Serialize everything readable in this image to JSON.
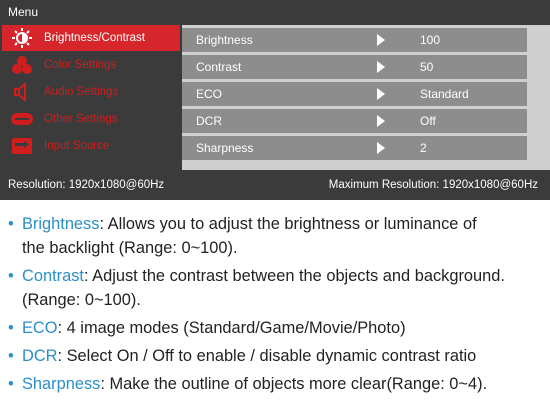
{
  "osd": {
    "title": "Menu",
    "menu_items": [
      {
        "label": "Brightness/Contrast",
        "icon": "brightness-icon",
        "active": true
      },
      {
        "label": "Color Settings",
        "icon": "color-icon",
        "active": false
      },
      {
        "label": "Audio Settings",
        "icon": "speaker-icon",
        "active": false
      },
      {
        "label": "Other Settings",
        "icon": "settings-icon",
        "active": false
      },
      {
        "label": "Input Source",
        "icon": "input-icon",
        "active": false
      }
    ],
    "submenu": [
      {
        "label": "Brightness",
        "value": "100"
      },
      {
        "label": "Contrast",
        "value": "50"
      },
      {
        "label": "ECO",
        "value": "Standard"
      },
      {
        "label": "DCR",
        "value": "Off"
      },
      {
        "label": "Sharpness",
        "value": "2"
      }
    ],
    "status": {
      "resolution": "Resolution: 1920x1080@60Hz",
      "max_resolution": "Maximum Resolution: 1920x1080@60Hz"
    }
  },
  "descriptions": [
    {
      "term": "Brightness",
      "text": ": Allows you to adjust the brightness or luminance of",
      "text2": "the backlight (Range: 0~100)."
    },
    {
      "term": "Contrast",
      "text": ": Adjust the contrast between the objects and background.",
      "text2": "(Range: 0~100)."
    },
    {
      "term": "ECO",
      "text": ": 4 image modes (Standard/Game/Movie/Photo)",
      "text2": ""
    },
    {
      "term": "DCR",
      "text": ": Select On / Off to enable / disable dynamic contrast ratio",
      "text2": ""
    },
    {
      "term": "Sharpness",
      "text": ": Make the outline of objects more clear(Range: 0~4).",
      "text2": ""
    }
  ],
  "colors": {
    "accent": "#d6262b",
    "term_blue": "#2a8fc7",
    "panel_dark": "#3b3b3b",
    "row_gray": "#8d8d8d"
  }
}
